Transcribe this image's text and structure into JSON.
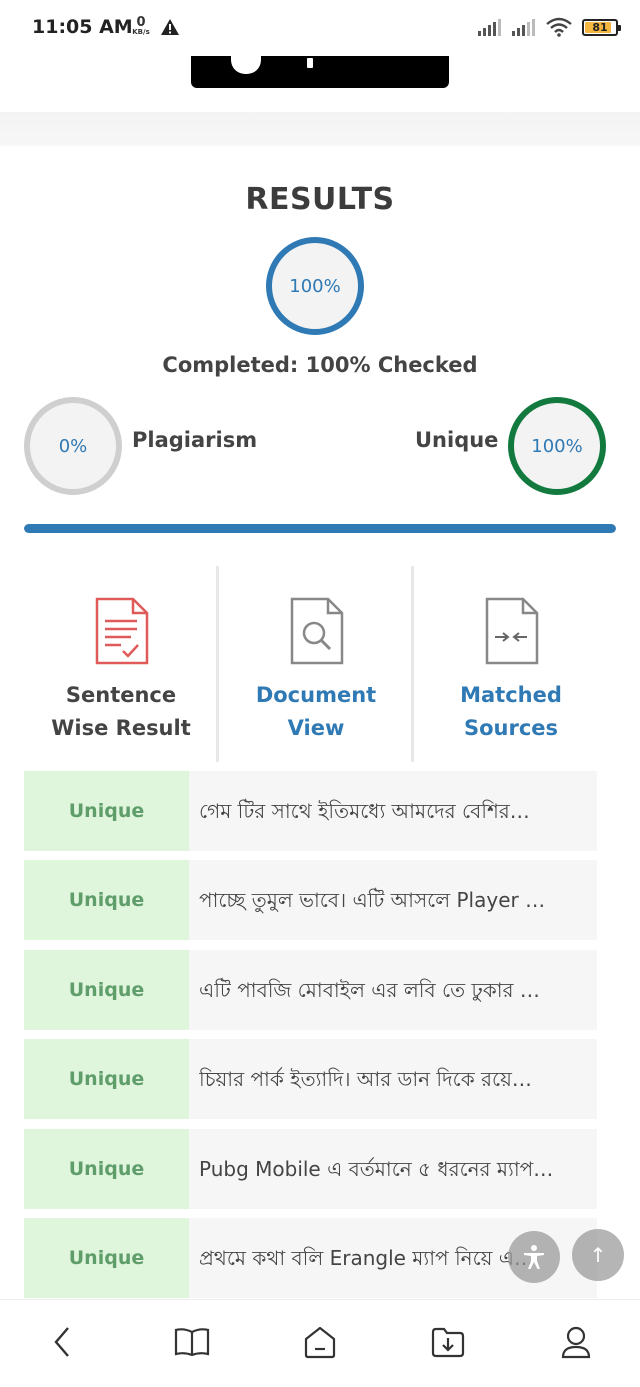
{
  "status_bar": {
    "time": "11:05 AM",
    "net_speed_value": "0",
    "net_speed_unit": "KB/s",
    "battery": "81",
    "icons": [
      "warning-icon",
      "signal-icon",
      "signal-icon",
      "wifi-icon",
      "battery-icon"
    ]
  },
  "results": {
    "title": "RESULTS",
    "overall_percent": "100%",
    "completed_text": "Completed: 100% Checked",
    "plagiarism_percent": "0%",
    "plagiarism_label": "Plagiarism",
    "unique_label": "Unique",
    "unique_percent": "100%",
    "progress_fraction": 1.0
  },
  "options": [
    {
      "line1": "Sentence",
      "line2": "Wise Result",
      "icon": "checklist-document-icon"
    },
    {
      "line1": "Document",
      "line2": "View",
      "icon": "document-search-icon"
    },
    {
      "line1": "Matched",
      "line2": "Sources",
      "icon": "compare-document-icon"
    }
  ],
  "rows": [
    {
      "status": "Unique",
      "sentence": "গেম টির সাথে ইতিমধ্যে আমদের বেশির…"
    },
    {
      "status": "Unique",
      "sentence": "পাচ্ছে তুমুল ভাবে। এটি আসলে Player …"
    },
    {
      "status": "Unique",
      "sentence": "এটি পাবজি মোবাইল এর লবি তে ঢুকার …"
    },
    {
      "status": "Unique",
      "sentence": "চিয়ার পার্ক ইত্যাদি। আর ডান দিকে রয়ে…"
    },
    {
      "status": "Unique",
      "sentence": "Pubg Mobile এ বর্তমানে ৫ ধরনের ম্যাপ…"
    },
    {
      "status": "Unique",
      "sentence": "প্রথমে কথা বলি Erangle ম্যাপ নিয়ে এ…"
    }
  ],
  "fab": {
    "scroll_top": "↑",
    "icons": [
      "accessibility-icon",
      "scroll-top-icon"
    ]
  },
  "bottom_nav": {
    "icons": [
      "back-icon",
      "bookmarks-icon",
      "home-icon",
      "downloads-icon",
      "profile-icon"
    ]
  },
  "colors": {
    "accent": "#2f79b5",
    "unique_green": "#127a3e",
    "unique_tag_bg": "#dff5dc",
    "danger": "#e05a5a"
  }
}
